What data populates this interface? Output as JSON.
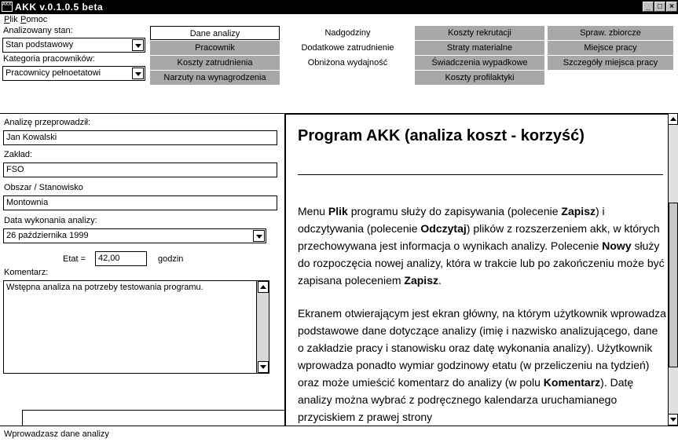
{
  "window": {
    "title": "AKK v.0.1.0.5  beta",
    "icon_text": "AKK",
    "buttons": [
      "_",
      "□",
      "×"
    ]
  },
  "menu": [
    {
      "label": "Plik"
    },
    {
      "label": "Pomoc"
    }
  ],
  "left": {
    "stan_label": "Analizowany stan:",
    "stan_value": "Stan podstawowy",
    "kategoria_label": "Kategoria pracowników:",
    "kategoria_value": "Pracownicy pełnoetatowi"
  },
  "tabs": [
    {
      "label": "Dane analizy"
    },
    {
      "label": "Pracownik"
    },
    {
      "label": "Koszty zatrudnienia"
    },
    {
      "label": "Narzuty na wynagrodzenia"
    },
    {
      "label": "Nadgodziny"
    },
    {
      "label": "Dodatkowe zatrudnienie"
    },
    {
      "label": "Obniżona wydajność"
    },
    {
      "label": "Koszty rekrutacji"
    },
    {
      "label": "Straty materialne"
    },
    {
      "label": "Świadczenia wypadkowe"
    },
    {
      "label": "Koszty profilaktyki"
    },
    {
      "label": "Spraw. zbiorcze"
    },
    {
      "label": "Miejsce pracy"
    },
    {
      "label": "Szczegóły miejsca pracy"
    }
  ],
  "form": {
    "analyst_label": "Analizę przeprowadził:",
    "analyst_value": "Jan Kowalski",
    "plant_label": "Zakład:",
    "plant_value": "FSO",
    "area_label": "Obszar / Stanowisko",
    "area_value": "Montownia",
    "date_label": "Data wykonania analizy:",
    "date_value": "26 października 1999",
    "etat_label": "Etat =",
    "etat_value": "42,00",
    "etat_unit": "godzin",
    "comment_label": "Komentarz:",
    "comment_value": "Wstępna analiza na potrzeby testowania programu."
  },
  "help": {
    "title": "Program AKK (analiza koszt - korzyść)",
    "p1_html": "Menu <b>Plik</b> programu służy do zapisywania (polecenie <b>Zapisz</b>) i odczytywania (polecenie <b>Odczytaj</b>) plików z rozszerzeniem akk, w których przechowywana jest informacja o wynikach analizy. Polecenie <b>Nowy</b> służy do rozpoczęcia nowej analizy, która w trakcie lub po zakończeniu może być zapisana poleceniem <b>Zapisz</b>.",
    "p2_html": "Ekranem otwierającym jest ekran główny, na którym użytkownik wprowadza podstawowe dane dotyczące analizy (imię i nazwisko analizującego, dane o zakładzie pracy i stanowisku oraz datę wykonania analizy). Użytkownik wprowadza ponadto wymiar godzinowy etatu (w przeliczeniu na tydzień) oraz może umieścić komentarz do analizy (w polu <b>Komentarz</b>). Datę analizy można wybrać z podręcznego kalendarza uruchamianego przyciskiem z prawej strony"
  },
  "status": {
    "text": "Wprowadzasz dane analizy"
  }
}
